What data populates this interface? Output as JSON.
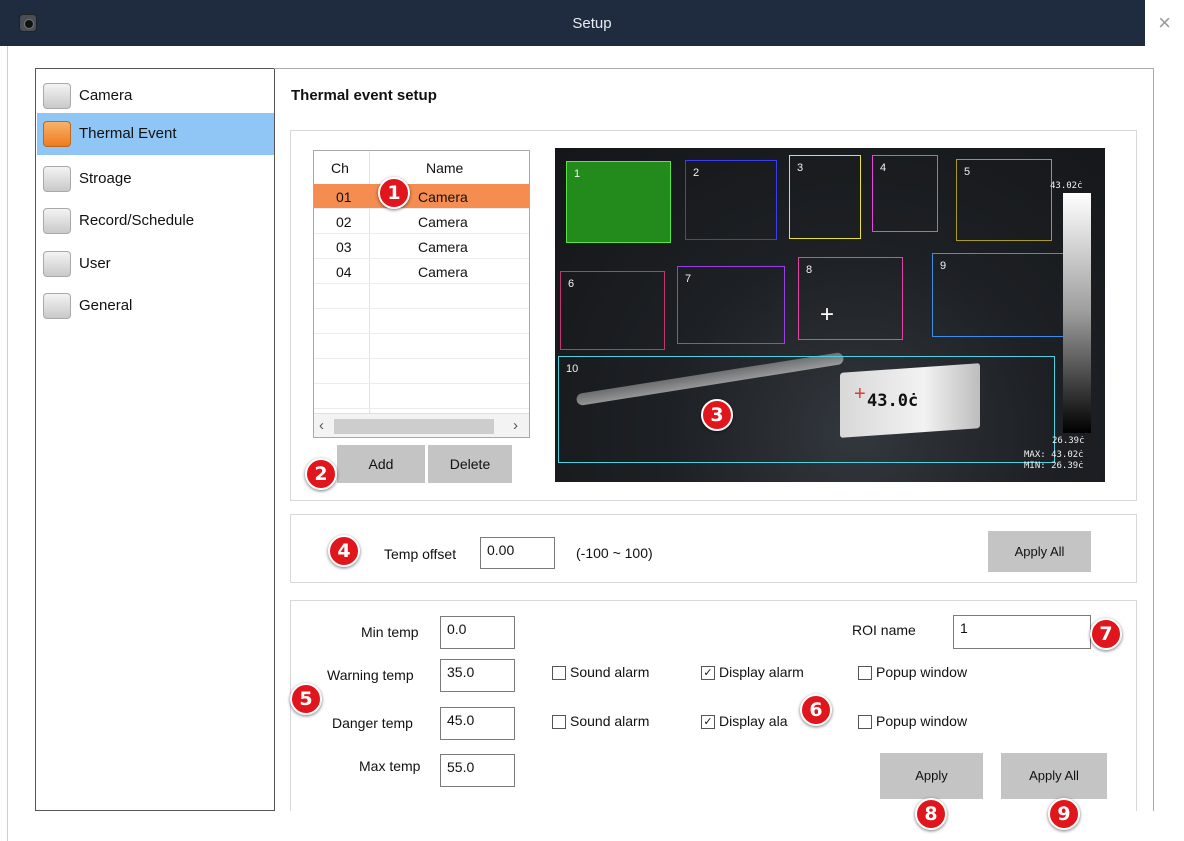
{
  "window": {
    "title": "Setup",
    "close_glyph": "×"
  },
  "sidebar": {
    "items": [
      {
        "label": "Camera"
      },
      {
        "label": "Thermal Event"
      },
      {
        "label": "Stroage"
      },
      {
        "label": "Record/Schedule"
      },
      {
        "label": "User"
      },
      {
        "label": "General"
      }
    ],
    "active_index": 1
  },
  "main": {
    "title": "Thermal event setup",
    "channel_table": {
      "columns": [
        "Ch",
        "Name"
      ],
      "rows": [
        {
          "ch": "01",
          "name": "Camera"
        },
        {
          "ch": "02",
          "name": "Camera"
        },
        {
          "ch": "03",
          "name": "Camera"
        },
        {
          "ch": "04",
          "name": "Camera"
        }
      ],
      "selected_index": 0
    },
    "add_label": "Add",
    "delete_label": "Delete",
    "thermal_view": {
      "roi_labels": [
        "1",
        "2",
        "3",
        "4",
        "5",
        "6",
        "7",
        "8",
        "9",
        "10"
      ],
      "scale_max": "43.02ċ",
      "scale_min": "26.39ċ",
      "max_readout": "MAX: 43.02ċ",
      "min_readout": "MIN: 26.39ċ",
      "spot_temp": "43.0ċ"
    },
    "offset": {
      "label": "Temp offset",
      "value": "0.00",
      "range": "(-100 ~ 100)",
      "apply_all_label": "Apply All"
    },
    "thresholds": {
      "min_label": "Min temp",
      "min_value": "0.0",
      "warning_label": "Warning temp",
      "warning_value": "35.0",
      "danger_label": "Danger temp",
      "danger_value": "45.0",
      "max_label": "Max temp",
      "max_value": "55.0",
      "roi_name_label": "ROI name",
      "roi_name_value": "1",
      "sound_alarm_label": "Sound alarm",
      "display_alarm_label": "Display alarm",
      "display_alarm_label_partial": "Display ala",
      "popup_label": "Popup window",
      "check_glyph": "✓",
      "warning_checks": {
        "sound": false,
        "display": true,
        "popup": false
      },
      "danger_checks": {
        "sound": false,
        "display": true,
        "popup": false
      },
      "apply_label": "Apply",
      "apply_all_label": "Apply All"
    }
  },
  "badges": [
    "1",
    "2",
    "3",
    "4",
    "5",
    "6",
    "7",
    "8",
    "9"
  ],
  "colors": {
    "accent_selected_row": "#f58c50",
    "sidebar_active": "#90c6f5",
    "badge": "#e0161c",
    "titlebar": "#1f2c40"
  }
}
